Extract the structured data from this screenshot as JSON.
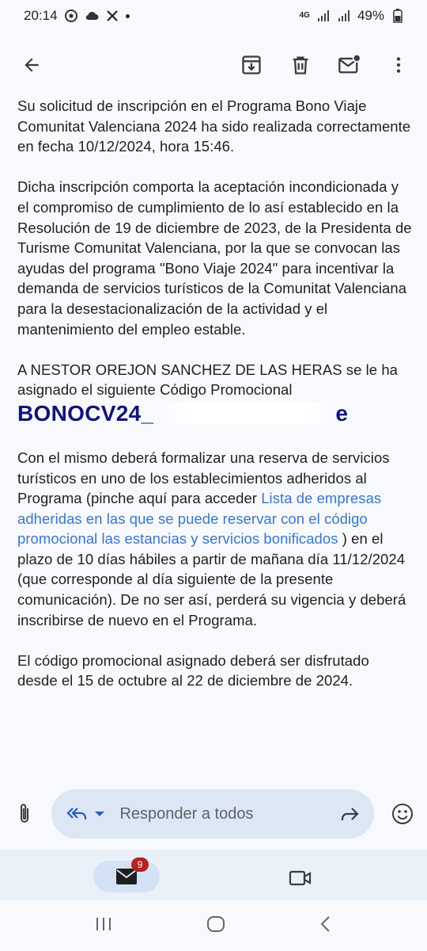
{
  "status_bar": {
    "time": "20:14",
    "network": "4G",
    "battery": "49%",
    "icons": [
      "chrome-icon",
      "cloud-icon",
      "x-icon",
      "notification-dot",
      "signal-icon",
      "signal-icon",
      "battery-icon"
    ]
  },
  "toolbar": {
    "icons": [
      "back-arrow-icon",
      "archive-icon",
      "delete-icon",
      "mark-unread-icon",
      "more-vert-icon"
    ]
  },
  "email": {
    "para1": "Su solicitud de inscripción en el Programa Bono Viaje Comunitat Valenciana 2024 ha sido realizada correctamente en fecha 10/12/2024, hora 15:46.",
    "para2": "Dicha inscripción comporta la aceptación incondicionada y el compromiso de cumplimiento de lo así establecido en la Resolución de 19 de diciembre de 2023, de la Presidenta de Turisme Comunitat Valenciana, por la que se convocan las ayudas del programa \"Bono Viaje 2024\" para incentivar la demanda de servicios turísticos de la Comunitat Valenciana para la desestacionalización de la actividad y el mantenimiento del empleo estable.",
    "para3": "A NESTOR OREJON SANCHEZ DE LAS HERAS se le ha asignado el siguiente Código Promocional",
    "promo_code_prefix": "BONOCV24_",
    "promo_code_suffix": "e",
    "para4_before": "Con el mismo deberá formalizar una reserva de servicios turísticos en uno de los establecimientos adheridos al Programa (pinche aquí para acceder ",
    "para4_link": "Lista de empresas adheridas en las que se puede reservar con el código promocional las estancias y servicios bonificados",
    "para4_after": " ) en el plazo de 10 días hábiles a partir de mañana día 11/12/2024 (que corresponde al día siguiente de la presente comunicación). De no ser así, perderá su vigencia y deberá inscribirse de nuevo en el Programa.",
    "para5": "El código promocional asignado deberá ser disfrutado desde el 15 de octubre al 22 de diciembre de 2024."
  },
  "reply_bar": {
    "placeholder": "Responder a todos"
  },
  "bottom_nav": {
    "mail_badge": "9"
  },
  "colors": {
    "link": "#3a77c9",
    "promo": "#11137a",
    "badge": "#b3261e",
    "pill": "#dde6f4"
  }
}
